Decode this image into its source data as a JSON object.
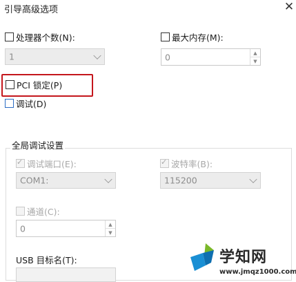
{
  "window": {
    "title": "引导高级选项",
    "close_glyph": "✕"
  },
  "processor": {
    "label": "处理器个数(N):",
    "checked": false,
    "value": "1"
  },
  "max_memory": {
    "label": "最大内存(M):",
    "checked": false,
    "value": "0"
  },
  "pci_lock": {
    "label": "PCI 锁定(P)",
    "checked": false,
    "highlighted": true,
    "highlight_color": "#c4161c"
  },
  "debug": {
    "label": "调试(D)",
    "checked": false
  },
  "global_debug": {
    "group_label": "全局调试设置",
    "debug_port": {
      "label": "调试端口(E):",
      "checked": true,
      "value": "COM1:"
    },
    "baud_rate": {
      "label": "波特率(B):",
      "checked": true,
      "value": "115200"
    },
    "channel": {
      "label": "通道(C):",
      "checked": false,
      "value": "0"
    },
    "usb_target": {
      "label": "USB 目标名(T):"
    }
  },
  "watermark": {
    "brand": "学知网",
    "url": "www.jmqz1000.com"
  },
  "colors": {
    "accent": "#2b6cc4",
    "highlight": "#c4161c",
    "disabled_text": "#a8a8a8"
  }
}
